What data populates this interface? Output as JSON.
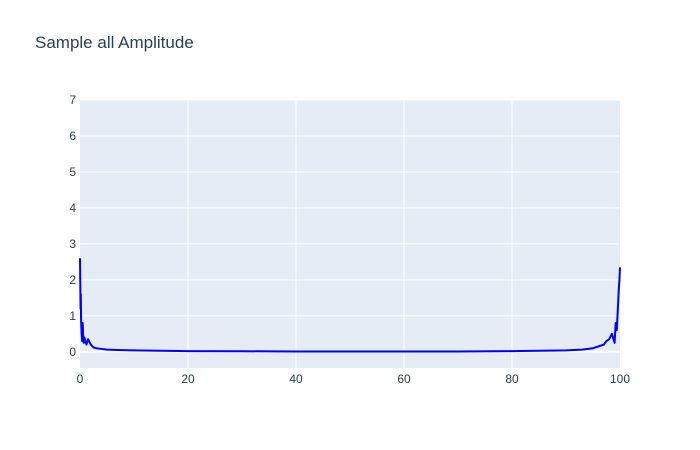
{
  "chart_data": {
    "type": "line",
    "title": "Sample all Amplitude",
    "xlabel": "",
    "ylabel": "",
    "xlim": [
      0,
      100
    ],
    "ylim": [
      -0.45,
      7
    ],
    "x_ticks": [
      0,
      20,
      40,
      60,
      80,
      100
    ],
    "y_ticks": [
      0,
      1,
      2,
      3,
      4,
      5,
      6,
      7
    ],
    "grid": true,
    "legend": "none",
    "colors": {
      "plot_background": "#e5ecf6",
      "grid": "#ffffff",
      "line": "#0000ff",
      "text": "#2a3f5f"
    },
    "series": [
      {
        "color": "#0000ff",
        "x": [
          0,
          0.05,
          0.1,
          0.15,
          0.2,
          0.3,
          0.4,
          0.5,
          0.6,
          0.7,
          0.8,
          1.0,
          1.2,
          1.5,
          2.0,
          2.5,
          3.0,
          4.0,
          5.0,
          7.0,
          10,
          15,
          20,
          30,
          40,
          50,
          60,
          70,
          80,
          85,
          90,
          93,
          95,
          96,
          97,
          97.5,
          98,
          98.5,
          99,
          99.2,
          99.4,
          99.6,
          99.8,
          99.9,
          100
        ],
        "y": [
          2.6,
          1.9,
          1.2,
          1.6,
          0.9,
          0.5,
          0.3,
          0.8,
          0.35,
          0.25,
          0.4,
          0.3,
          0.2,
          0.35,
          0.2,
          0.12,
          0.1,
          0.08,
          0.06,
          0.05,
          0.04,
          0.03,
          0.02,
          0.015,
          0.01,
          0.01,
          0.01,
          0.01,
          0.02,
          0.03,
          0.04,
          0.06,
          0.1,
          0.15,
          0.2,
          0.3,
          0.35,
          0.5,
          0.25,
          0.8,
          0.6,
          1.2,
          1.8,
          2.0,
          2.35
        ]
      }
    ]
  }
}
